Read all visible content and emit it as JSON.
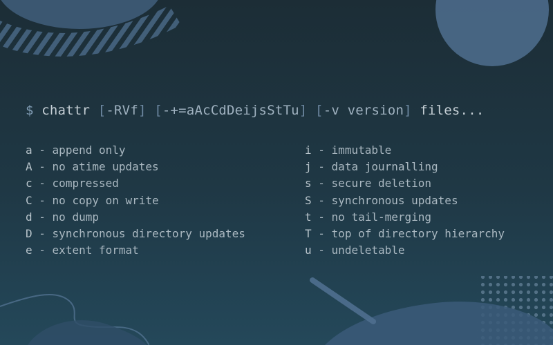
{
  "colors": {
    "background_top": "#1c2d36",
    "background_bottom": "#24485a",
    "accent_blue": "#4f6f8f",
    "text": "#aab8c1"
  },
  "command": {
    "prompt": "$",
    "name": "chattr",
    "opt1": "-RVf",
    "opt2": "-+=aAcCdDeijsStTu",
    "opt3": "-v version",
    "files": "files..."
  },
  "options_left": [
    {
      "key": "a",
      "desc": "append only"
    },
    {
      "key": "A",
      "desc": "no atime updates"
    },
    {
      "key": "c",
      "desc": "compressed"
    },
    {
      "key": "C",
      "desc": "no copy on write"
    },
    {
      "key": "d",
      "desc": "no dump"
    },
    {
      "key": "D",
      "desc": "synchronous directory updates"
    },
    {
      "key": "e",
      "desc": "extent format"
    }
  ],
  "options_right": [
    {
      "key": "i",
      "desc": "immutable"
    },
    {
      "key": "j",
      "desc": "data journalling"
    },
    {
      "key": "s",
      "desc": "secure deletion"
    },
    {
      "key": "S",
      "desc": "synchronous updates"
    },
    {
      "key": "t",
      "desc": "no tail-merging"
    },
    {
      "key": "T",
      "desc": "top of directory hierarchy"
    },
    {
      "key": "u",
      "desc": "undeletable"
    }
  ]
}
